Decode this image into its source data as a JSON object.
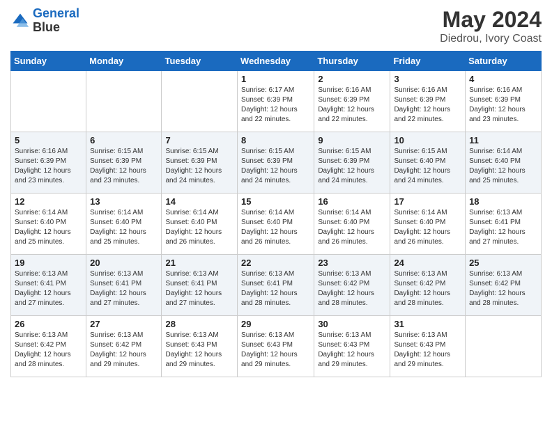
{
  "header": {
    "logo_line1": "General",
    "logo_line2": "Blue",
    "main_title": "May 2024",
    "subtitle": "Diedrou, Ivory Coast"
  },
  "days_of_week": [
    "Sunday",
    "Monday",
    "Tuesday",
    "Wednesday",
    "Thursday",
    "Friday",
    "Saturday"
  ],
  "weeks": [
    [
      {
        "day": "",
        "sunrise": "",
        "sunset": "",
        "daylight": ""
      },
      {
        "day": "",
        "sunrise": "",
        "sunset": "",
        "daylight": ""
      },
      {
        "day": "",
        "sunrise": "",
        "sunset": "",
        "daylight": ""
      },
      {
        "day": "1",
        "sunrise": "Sunrise: 6:17 AM",
        "sunset": "Sunset: 6:39 PM",
        "daylight": "Daylight: 12 hours and 22 minutes."
      },
      {
        "day": "2",
        "sunrise": "Sunrise: 6:16 AM",
        "sunset": "Sunset: 6:39 PM",
        "daylight": "Daylight: 12 hours and 22 minutes."
      },
      {
        "day": "3",
        "sunrise": "Sunrise: 6:16 AM",
        "sunset": "Sunset: 6:39 PM",
        "daylight": "Daylight: 12 hours and 22 minutes."
      },
      {
        "day": "4",
        "sunrise": "Sunrise: 6:16 AM",
        "sunset": "Sunset: 6:39 PM",
        "daylight": "Daylight: 12 hours and 23 minutes."
      }
    ],
    [
      {
        "day": "5",
        "sunrise": "Sunrise: 6:16 AM",
        "sunset": "Sunset: 6:39 PM",
        "daylight": "Daylight: 12 hours and 23 minutes."
      },
      {
        "day": "6",
        "sunrise": "Sunrise: 6:15 AM",
        "sunset": "Sunset: 6:39 PM",
        "daylight": "Daylight: 12 hours and 23 minutes."
      },
      {
        "day": "7",
        "sunrise": "Sunrise: 6:15 AM",
        "sunset": "Sunset: 6:39 PM",
        "daylight": "Daylight: 12 hours and 24 minutes."
      },
      {
        "day": "8",
        "sunrise": "Sunrise: 6:15 AM",
        "sunset": "Sunset: 6:39 PM",
        "daylight": "Daylight: 12 hours and 24 minutes."
      },
      {
        "day": "9",
        "sunrise": "Sunrise: 6:15 AM",
        "sunset": "Sunset: 6:39 PM",
        "daylight": "Daylight: 12 hours and 24 minutes."
      },
      {
        "day": "10",
        "sunrise": "Sunrise: 6:15 AM",
        "sunset": "Sunset: 6:40 PM",
        "daylight": "Daylight: 12 hours and 24 minutes."
      },
      {
        "day": "11",
        "sunrise": "Sunrise: 6:14 AM",
        "sunset": "Sunset: 6:40 PM",
        "daylight": "Daylight: 12 hours and 25 minutes."
      }
    ],
    [
      {
        "day": "12",
        "sunrise": "Sunrise: 6:14 AM",
        "sunset": "Sunset: 6:40 PM",
        "daylight": "Daylight: 12 hours and 25 minutes."
      },
      {
        "day": "13",
        "sunrise": "Sunrise: 6:14 AM",
        "sunset": "Sunset: 6:40 PM",
        "daylight": "Daylight: 12 hours and 25 minutes."
      },
      {
        "day": "14",
        "sunrise": "Sunrise: 6:14 AM",
        "sunset": "Sunset: 6:40 PM",
        "daylight": "Daylight: 12 hours and 26 minutes."
      },
      {
        "day": "15",
        "sunrise": "Sunrise: 6:14 AM",
        "sunset": "Sunset: 6:40 PM",
        "daylight": "Daylight: 12 hours and 26 minutes."
      },
      {
        "day": "16",
        "sunrise": "Sunrise: 6:14 AM",
        "sunset": "Sunset: 6:40 PM",
        "daylight": "Daylight: 12 hours and 26 minutes."
      },
      {
        "day": "17",
        "sunrise": "Sunrise: 6:14 AM",
        "sunset": "Sunset: 6:40 PM",
        "daylight": "Daylight: 12 hours and 26 minutes."
      },
      {
        "day": "18",
        "sunrise": "Sunrise: 6:13 AM",
        "sunset": "Sunset: 6:41 PM",
        "daylight": "Daylight: 12 hours and 27 minutes."
      }
    ],
    [
      {
        "day": "19",
        "sunrise": "Sunrise: 6:13 AM",
        "sunset": "Sunset: 6:41 PM",
        "daylight": "Daylight: 12 hours and 27 minutes."
      },
      {
        "day": "20",
        "sunrise": "Sunrise: 6:13 AM",
        "sunset": "Sunset: 6:41 PM",
        "daylight": "Daylight: 12 hours and 27 minutes."
      },
      {
        "day": "21",
        "sunrise": "Sunrise: 6:13 AM",
        "sunset": "Sunset: 6:41 PM",
        "daylight": "Daylight: 12 hours and 27 minutes."
      },
      {
        "day": "22",
        "sunrise": "Sunrise: 6:13 AM",
        "sunset": "Sunset: 6:41 PM",
        "daylight": "Daylight: 12 hours and 28 minutes."
      },
      {
        "day": "23",
        "sunrise": "Sunrise: 6:13 AM",
        "sunset": "Sunset: 6:42 PM",
        "daylight": "Daylight: 12 hours and 28 minutes."
      },
      {
        "day": "24",
        "sunrise": "Sunrise: 6:13 AM",
        "sunset": "Sunset: 6:42 PM",
        "daylight": "Daylight: 12 hours and 28 minutes."
      },
      {
        "day": "25",
        "sunrise": "Sunrise: 6:13 AM",
        "sunset": "Sunset: 6:42 PM",
        "daylight": "Daylight: 12 hours and 28 minutes."
      }
    ],
    [
      {
        "day": "26",
        "sunrise": "Sunrise: 6:13 AM",
        "sunset": "Sunset: 6:42 PM",
        "daylight": "Daylight: 12 hours and 28 minutes."
      },
      {
        "day": "27",
        "sunrise": "Sunrise: 6:13 AM",
        "sunset": "Sunset: 6:42 PM",
        "daylight": "Daylight: 12 hours and 29 minutes."
      },
      {
        "day": "28",
        "sunrise": "Sunrise: 6:13 AM",
        "sunset": "Sunset: 6:43 PM",
        "daylight": "Daylight: 12 hours and 29 minutes."
      },
      {
        "day": "29",
        "sunrise": "Sunrise: 6:13 AM",
        "sunset": "Sunset: 6:43 PM",
        "daylight": "Daylight: 12 hours and 29 minutes."
      },
      {
        "day": "30",
        "sunrise": "Sunrise: 6:13 AM",
        "sunset": "Sunset: 6:43 PM",
        "daylight": "Daylight: 12 hours and 29 minutes."
      },
      {
        "day": "31",
        "sunrise": "Sunrise: 6:13 AM",
        "sunset": "Sunset: 6:43 PM",
        "daylight": "Daylight: 12 hours and 29 minutes."
      },
      {
        "day": "",
        "sunrise": "",
        "sunset": "",
        "daylight": ""
      }
    ]
  ]
}
